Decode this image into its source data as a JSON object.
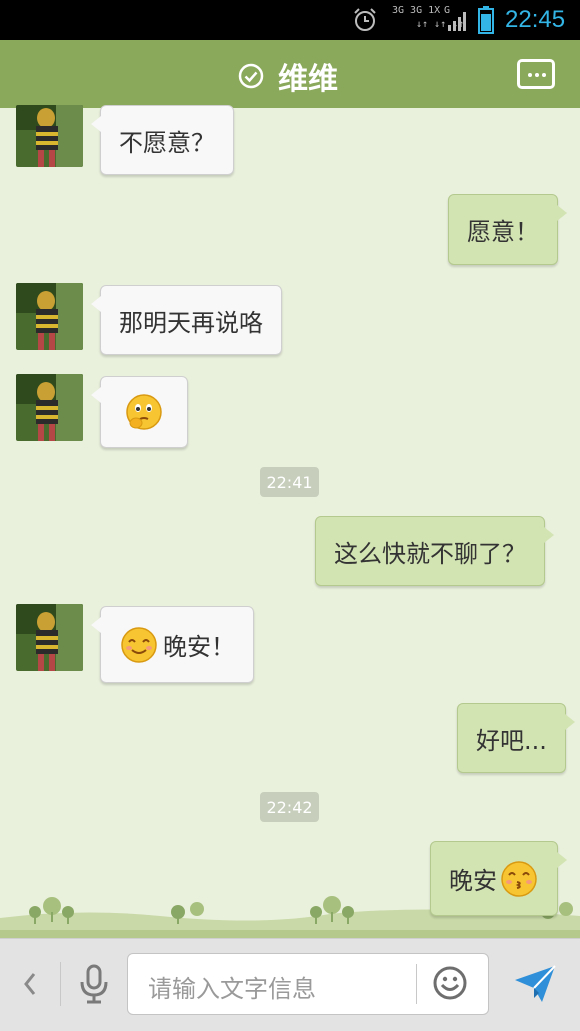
{
  "status_bar": {
    "time": "22:45",
    "net_top": "3G 3G 1X",
    "net_bottom": "↓↑ ↓↑ ↓↑",
    "network_g": "G",
    "battery_color": "#33b5e5"
  },
  "header": {
    "title": "维维",
    "verified_icon": "check-circle-icon",
    "more_icon": "chat-more-icon"
  },
  "messages": [
    {
      "from": "contact",
      "text": "不愿意？"
    },
    {
      "from": "me",
      "text": "愿意！"
    },
    {
      "from": "contact",
      "text": "那明天再说咯"
    },
    {
      "from": "contact",
      "emoji": "thinking-emoji"
    },
    {
      "type": "timestamp",
      "text": "22:41"
    },
    {
      "from": "me",
      "text": "这么快就不聊了？"
    },
    {
      "from": "contact",
      "emoji": "smile-emoji",
      "text": "晚安！"
    },
    {
      "from": "me",
      "text": "好吧..."
    },
    {
      "type": "timestamp",
      "text": "22:42"
    },
    {
      "from": "me",
      "text": "晚安",
      "emoji": "kiss-emoji"
    }
  ],
  "input": {
    "placeholder": "请输入文字信息",
    "back_icon": "chevron-left-icon",
    "voice_icon": "microphone-icon",
    "emoji_icon": "smiley-icon",
    "send_icon": "paper-plane-icon"
  },
  "colors": {
    "title_bar": "#8ba95a",
    "chat_background": "#e9f0dc",
    "outgoing_bubble": "#d3e4b3",
    "incoming_bubble": "#f8f8f8",
    "send_icon": "#2f8fd8"
  }
}
